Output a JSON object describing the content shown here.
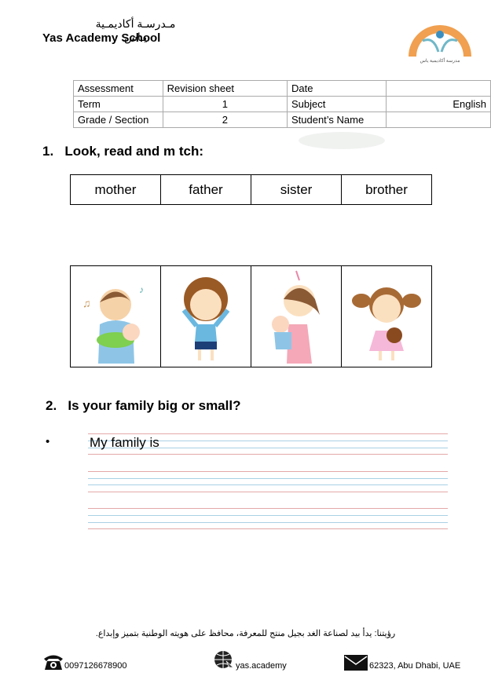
{
  "header": {
    "school_name_ar": "مـدرسـة أكاديمـية يـاس",
    "school_name_en": "Yas Academy School",
    "logo_text": "YAS ACADEMY SCHOOL",
    "logo_text_ar": "مدرسة أكاديمية ياس"
  },
  "info_table": {
    "rows": [
      [
        "Assessment",
        "Revision sheet",
        "Date",
        ""
      ],
      [
        "Term",
        "1",
        "Subject",
        "English"
      ],
      [
        "Grade / Section",
        "2",
        "Student’s Name",
        ""
      ]
    ]
  },
  "question1": {
    "number": "1.",
    "title": "Look, read and m  tch:",
    "words": [
      "mother",
      "father",
      "sister",
      "brother"
    ],
    "pictures": [
      "father-holding-baby",
      "boy",
      "mother-holding-baby",
      "girl-with-teddy"
    ]
  },
  "question2": {
    "number": "2.",
    "title": "Is your family big or small?",
    "bullet": "•",
    "answer_prompt": "My family is"
  },
  "footer": {
    "vision_ar": "رؤيتنا: يدأ بيد لصناعة الغد بجيل منتج للمعرفة، محافظ على هويته الوطنية بتميز وإبداع.",
    "phone": "0097126678900",
    "website": "yas.academy",
    "address": "62323, Abu Dhabi, UAE"
  },
  "colors": {
    "logo_orange": "#f0a050",
    "logo_blue": "#3a8fc0",
    "guide_red": "#e4a8a8",
    "guide_blue": "#a9d0e4"
  }
}
